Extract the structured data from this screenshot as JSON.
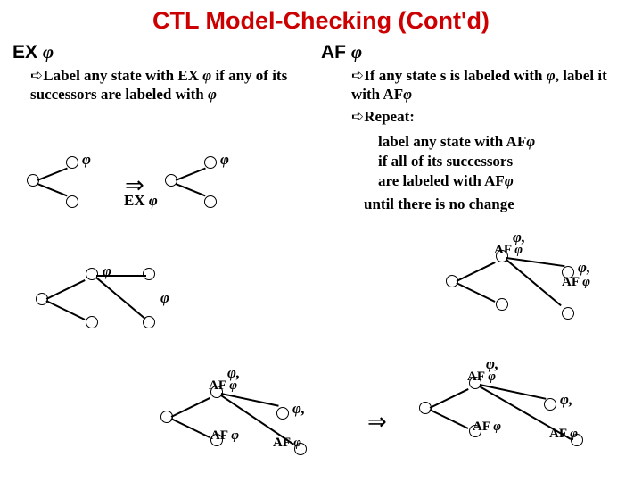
{
  "title": "CTL Model-Checking (Cont'd)",
  "left": {
    "heading_prefix": "EX ",
    "phi": "φ",
    "rule_pre": "Label any state with EX ",
    "rule_post": " if any of its successors are labeled with ",
    "exlabel_pre": "EX ",
    "exlabel_phi": "φ"
  },
  "right": {
    "heading_prefix": "AF ",
    "phi": "φ",
    "rule1_pre": "If any state s is labeled with ",
    "rule1_mid": ", label it with AF",
    "repeat": "Repeat:",
    "line_a": "label any state with AF",
    "line_b1": "if all of its successors",
    "line_b2": "are labeled  with AF",
    "until": "until there is no change"
  },
  "arrow": "➪",
  "transform": "⇒",
  "philbl": "φ",
  "phicomma": "φ,",
  "afphi_pre": "AF ",
  "afphi_phi": "φ"
}
